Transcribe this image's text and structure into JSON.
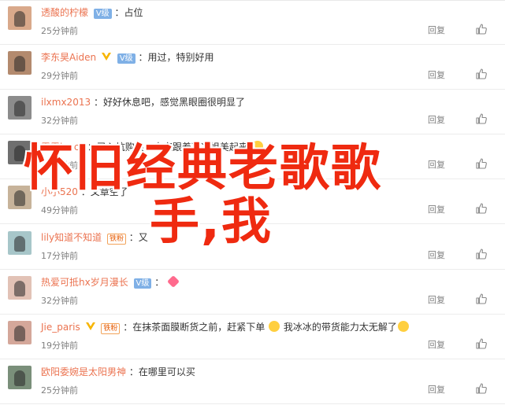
{
  "comments": [
    {
      "username": "透酸的柠檬",
      "badge": "vip",
      "vip_label": "V级",
      "fan": "",
      "text": "：占位",
      "emoji": "",
      "time": "25分钟前",
      "reply": "回复"
    },
    {
      "username": "李东昊Aiden",
      "badge": "v+vip",
      "vip_label": "V级",
      "fan": "",
      "text": "：用过，特别好用",
      "emoji": "",
      "time": "29分钟前",
      "reply": "回复"
    },
    {
      "username": "ilxmx2013",
      "badge": "",
      "vip_label": "",
      "fan": "",
      "text": "：好好休息吧，感觉黑眼圈很明显了",
      "emoji": "",
      "time": "32分钟前",
      "reply": "回复"
    },
    {
      "username": "露露lyecc",
      "badge": "",
      "vip_label": "",
      "fan": "",
      "text": "：已入坑购买，大家跟着冰冰姐美起来",
      "emoji": "smile",
      "time": "39分钟前",
      "reply": "回复"
    },
    {
      "username": "小小520",
      "badge": "",
      "vip_label": "",
      "fan": "",
      "text": "：文章空了",
      "emoji": "",
      "time": "49分钟前",
      "reply": "回复"
    },
    {
      "username": "lily知道不知道",
      "badge": "fan",
      "vip_label": "",
      "fan": "铁粉",
      "text": "：又",
      "emoji": "",
      "time": "17分钟前",
      "reply": "回复"
    },
    {
      "username": "热爱可抵hx岁月漫长",
      "badge": "vip",
      "vip_label": "V级",
      "fan": "",
      "text": "：",
      "emoji": "heart",
      "time": "32分钟前",
      "reply": "回复"
    },
    {
      "username": "Jie_paris",
      "badge": "v+fan",
      "vip_label": "",
      "fan": "铁粉",
      "text": "：在抹茶面膜断货之前，赶紧下单",
      "emoji": "cat",
      "text2": "我冰冰的带货能力太无解了",
      "time": "19分钟前",
      "reply": "回复"
    },
    {
      "username": "欧阳委婉是太阳男神",
      "badge": "",
      "vip_label": "",
      "fan": "",
      "text": "：在哪里可以买",
      "emoji": "",
      "time": "25分钟前",
      "reply": "回复"
    }
  ],
  "overlay": {
    "line1": "怀旧经典老歌歌",
    "line2": "手,我"
  },
  "colors": {
    "username": "#eb7350",
    "overlay": "#ef2a10",
    "meta": "#808080"
  },
  "icons": {
    "like": "thumbs-up-icon",
    "verified": "verified-v-icon"
  }
}
